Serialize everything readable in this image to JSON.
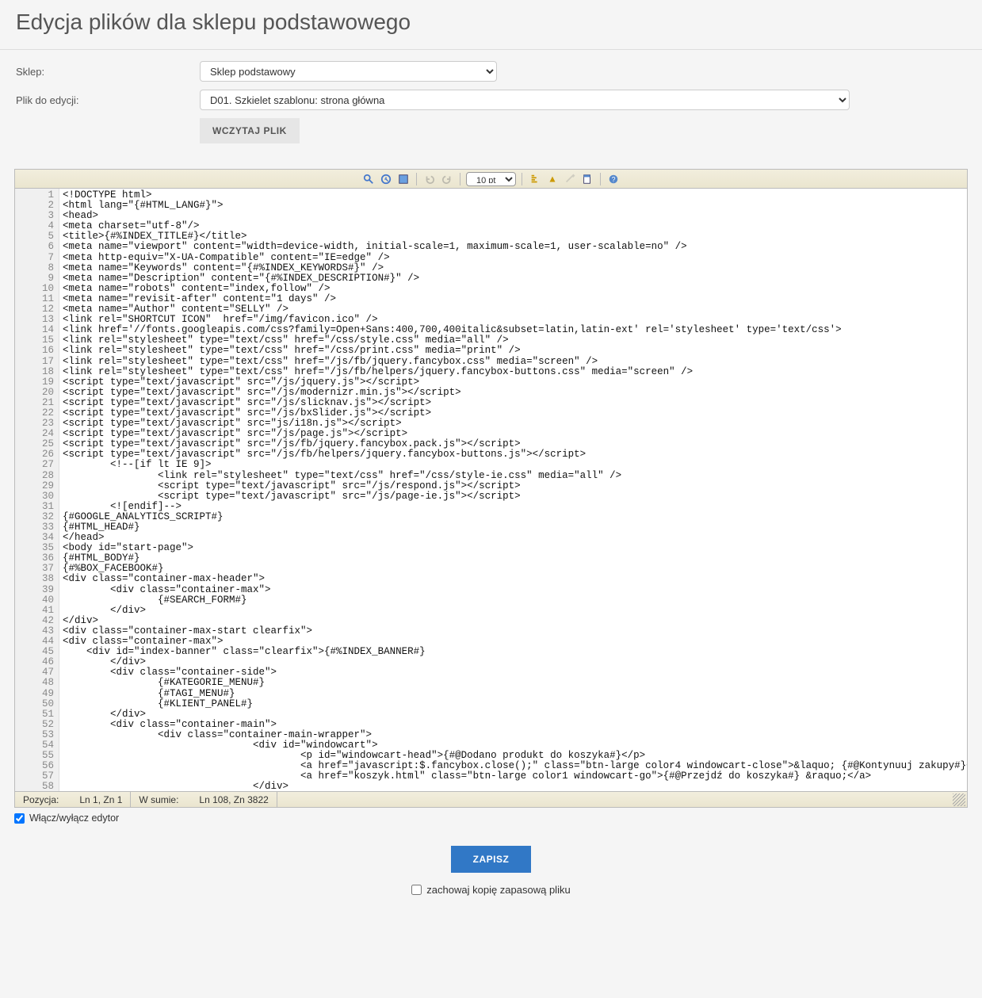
{
  "header": {
    "title": "Edycja plików dla sklepu podstawowego"
  },
  "form": {
    "shop_label": "Sklep:",
    "shop_value": "Sklep podstawowy",
    "file_label": "Plik do edycji:",
    "file_value": "D01. Szkielet szablonu: strona główna",
    "load_button": "WCZYTAJ PLIK"
  },
  "toolbar": {
    "fontsize": "10 pt",
    "icons": [
      "search-icon",
      "goto-icon",
      "fullscreen-icon",
      "undo-icon",
      "redo-icon",
      "syntax-icon",
      "highlight-icon",
      "reset-icon",
      "newdoc-icon",
      "help-icon"
    ]
  },
  "code_lines": [
    "<!DOCTYPE html>",
    "<html lang=\"{#HTML_LANG#}\">",
    "<head>",
    "<meta charset=\"utf-8\"/>",
    "<title>{#%INDEX_TITLE#}</title>",
    "<meta name=\"viewport\" content=\"width=device-width, initial-scale=1, maximum-scale=1, user-scalable=no\" />",
    "<meta http-equiv=\"X-UA-Compatible\" content=\"IE=edge\" />",
    "<meta name=\"Keywords\" content=\"{#%INDEX_KEYWORDS#}\" />",
    "<meta name=\"Description\" content=\"{#%INDEX_DESCRIPTION#}\" />",
    "<meta name=\"robots\" content=\"index,follow\" />",
    "<meta name=\"revisit-after\" content=\"1 days\" />",
    "<meta name=\"Author\" content=\"SELLY\" />",
    "<link rel=\"SHORTCUT ICON\"  href=\"/img/favicon.ico\" />",
    "<link href='//fonts.googleapis.com/css?family=Open+Sans:400,700,400italic&subset=latin,latin-ext' rel='stylesheet' type='text/css'>",
    "<link rel=\"stylesheet\" type=\"text/css\" href=\"/css/style.css\" media=\"all\" />",
    "<link rel=\"stylesheet\" type=\"text/css\" href=\"/css/print.css\" media=\"print\" />",
    "<link rel=\"stylesheet\" type=\"text/css\" href=\"/js/fb/jquery.fancybox.css\" media=\"screen\" />",
    "<link rel=\"stylesheet\" type=\"text/css\" href=\"/js/fb/helpers/jquery.fancybox-buttons.css\" media=\"screen\" />",
    "<script type=\"text/javascript\" src=\"/js/jquery.js\"></script>",
    "<script type=\"text/javascript\" src=\"/js/modernizr.min.js\"></script>",
    "<script type=\"text/javascript\" src=\"/js/slicknav.js\"></script>",
    "<script type=\"text/javascript\" src=\"/js/bxSlider.js\"></script>",
    "<script type=\"text/javascript\" src=\"js/i18n.js\"></script>",
    "<script type=\"text/javascript\" src=\"/js/page.js\"></script>",
    "<script type=\"text/javascript\" src=\"/js/fb/jquery.fancybox.pack.js\"></script>",
    "<script type=\"text/javascript\" src=\"/js/fb/helpers/jquery.fancybox-buttons.js\"></script>",
    "        <!--[if lt IE 9]>",
    "                <link rel=\"stylesheet\" type=\"text/css\" href=\"/css/style-ie.css\" media=\"all\" />",
    "                <script type=\"text/javascript\" src=\"/js/respond.js\"></script>",
    "                <script type=\"text/javascript\" src=\"/js/page-ie.js\"></script>",
    "        <![endif]-->",
    "{#GOOGLE_ANALYTICS_SCRIPT#}",
    "{#HTML_HEAD#}",
    "</head>",
    "<body id=\"start-page\">",
    "{#HTML_BODY#}",
    "{#%BOX_FACEBOOK#}",
    "<div class=\"container-max-header\">",
    "        <div class=\"container-max\">",
    "                {#SEARCH_FORM#}",
    "        </div>",
    "</div>",
    "<div class=\"container-max-start clearfix\">",
    "<div class=\"container-max\">",
    "    <div id=\"index-banner\" class=\"clearfix\">{#%INDEX_BANNER#}",
    "        </div>",
    "        <div class=\"container-side\">",
    "                {#KATEGORIE_MENU#}",
    "                {#TAGI_MENU#}",
    "                {#KLIENT_PANEL#}",
    "        </div>",
    "        <div class=\"container-main\">",
    "                <div class=\"container-main-wrapper\">",
    "                                <div id=\"windowcart\">",
    "                                        <p id=\"windowcart-head\">{#@Dodano produkt do koszyka#}</p>",
    "                                        <a href=\"javascript:$.fancybox.close();\" class=\"btn-large color4 windowcart-close\">&laquo; {#@Kontynuuj zakupy#}</a>",
    "                                        <a href=\"koszyk.html\" class=\"btn-large color1 windowcart-go\">{#@Przejdź do koszyka#} &raquo;</a>",
    "                                </div>"
  ],
  "status": {
    "pos_label": "Pozycja:",
    "pos_value": "Ln 1, Zn 1",
    "total_label": "W sumie:",
    "total_value": "Ln 108, Zn 3822"
  },
  "toggle": {
    "label": "Włącz/wyłącz edytor",
    "checked": true
  },
  "footer": {
    "save_label": "ZAPISZ",
    "backup_label": "zachowaj kopię zapasową pliku",
    "backup_checked": false
  }
}
